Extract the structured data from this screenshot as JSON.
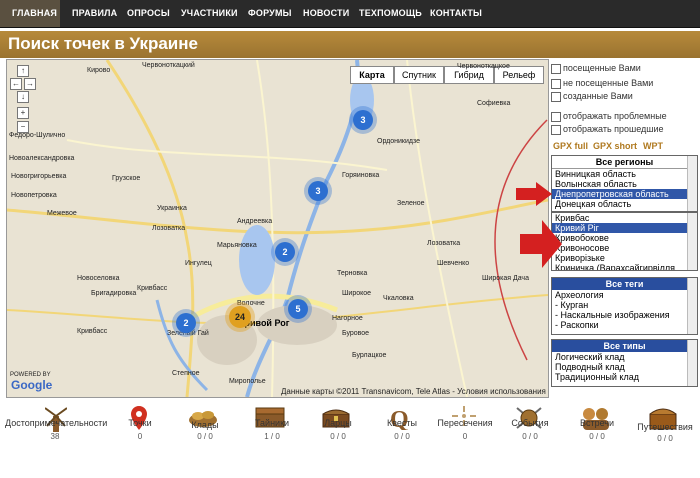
{
  "nav": {
    "items": [
      {
        "label": "ГЛАВНАЯ",
        "active": true
      },
      {
        "label": "ПРАВИЛА",
        "active": false
      },
      {
        "label": "ОПРОСЫ",
        "active": false
      },
      {
        "label": "УЧАСТНИКИ",
        "active": false
      },
      {
        "label": "ФОРУМЫ",
        "active": false
      },
      {
        "label": "НОВОСТИ",
        "active": false
      },
      {
        "label": "ТЕХПОМОЩЬ",
        "active": false
      },
      {
        "label": "КОНТАКТЫ",
        "active": false
      }
    ]
  },
  "page": {
    "title": "Поиск точек в Украине"
  },
  "map": {
    "types": [
      "Карта",
      "Спутник",
      "Гибрид",
      "Рельеф"
    ],
    "selected_type": "Карта",
    "clusters": [
      "3",
      "3",
      "2",
      "2",
      "24",
      "5"
    ],
    "city": "Кривой Рог",
    "towns": [
      "Кирово",
      "Червоноткацкий",
      "Червоноткацкое",
      "Федоро-Шулично",
      "Новоалександровка",
      "Новогригорьевка",
      "Новопетровка",
      "Межевое",
      "Грузское",
      "Украинка",
      "Лозоватка",
      "Марьяновка",
      "Андреевка",
      "Ингулец",
      "Кривбасс",
      "Новоселовка",
      "Бригадировка",
      "Кривбасс",
      "Зеленый Гай",
      "Степное",
      "Ордоникидзе",
      "Горяиновка",
      "Терновка",
      "Широкое",
      "Чкаловка",
      "Мирополье",
      "Нагорное",
      "Буровое",
      "Бурлацкое",
      "Зеленое",
      "Лозоватка",
      "Шевченко",
      "Софиевка",
      "Широкая Дача",
      "Волочне"
    ],
    "logo": "Google",
    "powered": "POWERED BY",
    "copyright": "Данные карты ©2011 Transnavicom, Tele Atlas - Условия использования"
  },
  "filters": {
    "checks": [
      "посещенные Вами",
      "не посещенные Вами",
      "созданные Вами",
      "отображать проблемные",
      "отображать прошедшие"
    ],
    "gpx": [
      "GPX full",
      "GPX short",
      "WPT"
    ]
  },
  "regions": {
    "header": "Все регионы",
    "options": [
      "Винницкая область",
      "Волынская область",
      "Днепропетровская область",
      "Донецкая область"
    ],
    "selected": "Днепропетровская область"
  },
  "cities": {
    "options": [
      "Кривбас",
      "Кривий Ріг",
      "Кривобокове",
      "Кривоносове",
      "Криворізьке",
      "Криничка (Варахсайгирвілля"
    ],
    "selected": "Кривий Ріг"
  },
  "tags": {
    "header": "Все теги",
    "options": [
      "Археология",
      "- Курган",
      "- Наскальные изображения",
      "- Раскопки"
    ]
  },
  "types": {
    "header": "Все типы",
    "options": [
      "Логический клад",
      "Подводный клад",
      "Традиционный клад"
    ]
  },
  "categories": [
    {
      "label": "Достопримечательности",
      "count": "38",
      "icon": "windmill-icon"
    },
    {
      "label": "Точки",
      "count": "0",
      "icon": "map-pin-icon"
    },
    {
      "label": "Клады",
      "count": "0 / 0",
      "icon": "treasure-coins-icon"
    },
    {
      "label": "Тайники",
      "count": "1 / 0",
      "icon": "cache-box-icon"
    },
    {
      "label": "Ларцы",
      "count": "0 / 0",
      "icon": "chest-icon"
    },
    {
      "label": "Квесты",
      "count": "0 / 0",
      "icon": "quest-q-icon"
    },
    {
      "label": "Пересечения",
      "count": "0",
      "icon": "crosshair-icon"
    },
    {
      "label": "События",
      "count": "0 / 0",
      "icon": "shield-swords-icon"
    },
    {
      "label": "Встречи",
      "count": "0 / 0",
      "icon": "people-meeting-icon"
    },
    {
      "label": "Путешествия",
      "count": "0 / 0",
      "icon": "travel-chest-icon"
    }
  ],
  "colors": {
    "accent": "#b78a3b",
    "nav": "#2a2a2a",
    "selection": "#3057a8",
    "cluster_blue": "#2d6fd0",
    "cluster_orange": "#e0a020"
  }
}
